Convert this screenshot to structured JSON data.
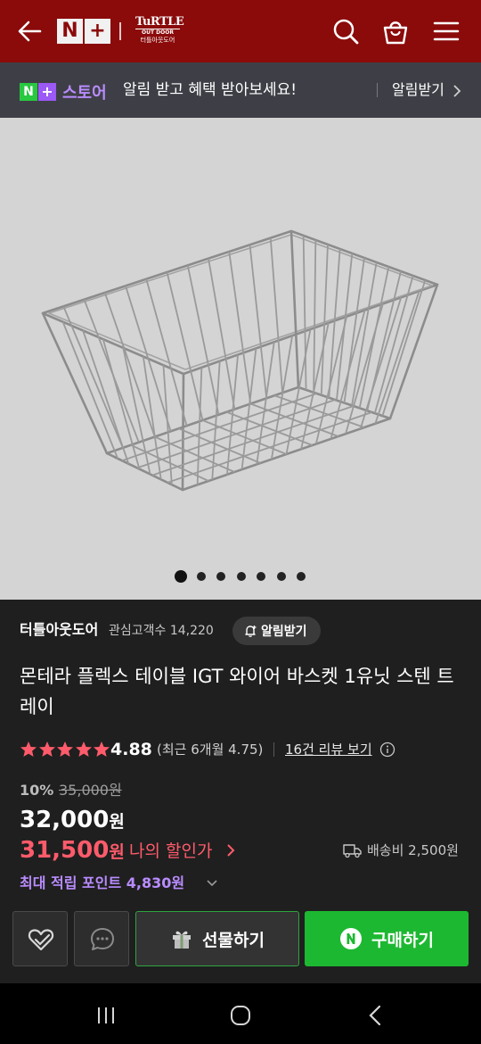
{
  "topbar": {
    "logo_n": "N",
    "logo_plus": "+",
    "brand_line1": "TuRTLE",
    "brand_line2": "OUT DOOR",
    "brand_line3": "터틀아웃도어"
  },
  "notice": {
    "store_label": "스토어",
    "text": "알림 받고 혜택 받아보세요!",
    "button": "알림받기"
  },
  "gallery": {
    "total_images": 7,
    "current_index": 1
  },
  "seller": {
    "name": "터틀아웃도어",
    "followers": "관심고객수 14,220",
    "alarm_button": "알림받기"
  },
  "product": {
    "title": "몬테라 플렉스 테이블 IGT 와이어 바스켓 1유닛 스텐 트레이",
    "rating_stars": 5,
    "rating": "4.88",
    "recent_rating": "(최근 6개월 4.75)",
    "reviews_link": "16건 리뷰 보기",
    "discount": "10%",
    "original_price": "35,000원",
    "price": "32,000",
    "price_unit": "원",
    "my_price": "31,500",
    "my_price_unit": "원",
    "my_price_label": "나의 할인가",
    "shipping": "배송비 2,500원",
    "points": "최대 적립 포인트 4,830원"
  },
  "actions": {
    "gift": "선물하기",
    "buy": "구매하기"
  },
  "colors": {
    "header": "#8b0a0a",
    "accent_green": "#1db831",
    "sale_pink": "#ff5b6b",
    "points_purple": "#b98cff"
  }
}
